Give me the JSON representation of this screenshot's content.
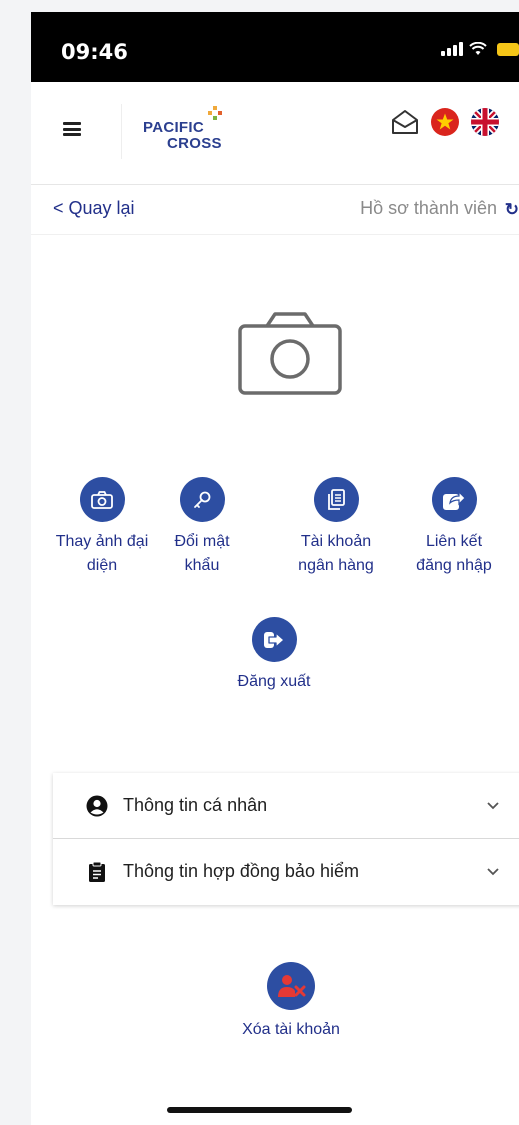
{
  "status_bar": {
    "time": "09:46"
  },
  "header": {
    "brand_line1": "PACIFIC",
    "brand_line2": "CROSS",
    "icons": [
      "menu-icon",
      "mail-icon",
      "vietnam-flag-icon",
      "uk-flag-icon"
    ]
  },
  "subbar": {
    "back_label": "< Quay lại",
    "title": "Hồ sơ thành viên"
  },
  "actions": [
    {
      "label": "Thay ảnh đại diện",
      "icon": "camera-icon"
    },
    {
      "label": "Đổi mật khẩu",
      "icon": "key-icon"
    },
    {
      "label": "Tài khoản ngân hàng",
      "icon": "copy-icon"
    },
    {
      "label": "Liên kết đăng nhập",
      "icon": "share-icon"
    },
    {
      "label": "Đăng xuất",
      "icon": "logout-icon"
    }
  ],
  "sections": [
    {
      "label": "Thông tin cá nhân",
      "icon": "user-circle-icon"
    },
    {
      "label": "Thông tin hợp đồng bảo hiểm",
      "icon": "clipboard-icon"
    }
  ],
  "delete_account": {
    "label": "Xóa tài khoản",
    "icon": "user-delete-icon"
  },
  "colors": {
    "primary": "#2d4ea2",
    "link": "#22308a",
    "statusbar": "#000000"
  }
}
